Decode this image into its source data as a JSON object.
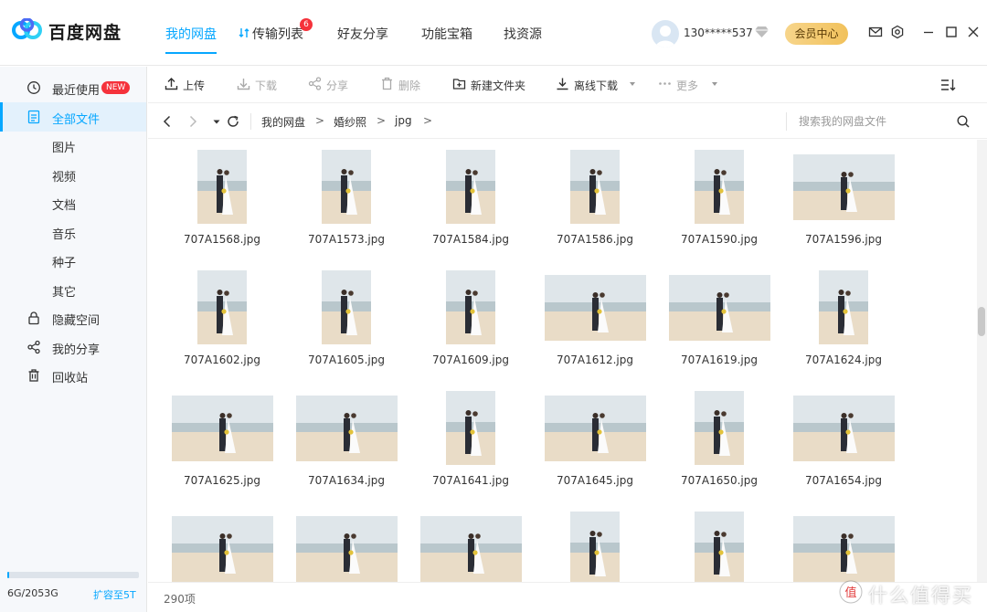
{
  "app": {
    "brand": "百度网盘"
  },
  "nav": {
    "tabs": [
      {
        "label": "我的网盘"
      },
      {
        "label": "传输列表",
        "badge": "6"
      },
      {
        "label": "好友分享"
      },
      {
        "label": "功能宝箱"
      },
      {
        "label": "找资源"
      }
    ]
  },
  "user": {
    "name": "130*****537",
    "vip_button": "会员中心"
  },
  "sidebar": {
    "items": [
      {
        "label": "最近使用",
        "icon": "clock-icon",
        "badge": "NEW"
      },
      {
        "label": "全部文件",
        "icon": "document-icon"
      },
      {
        "label": "图片"
      },
      {
        "label": "视频"
      },
      {
        "label": "文档"
      },
      {
        "label": "音乐"
      },
      {
        "label": "种子"
      },
      {
        "label": "其它"
      },
      {
        "label": "隐藏空间",
        "icon": "lock-icon"
      },
      {
        "label": "我的分享",
        "icon": "share-icon"
      },
      {
        "label": "回收站",
        "icon": "trash-icon"
      }
    ],
    "storage": {
      "text": "6G/2053G",
      "used_fraction": 0.003,
      "expand": "扩容至5T"
    }
  },
  "toolbar": {
    "upload": "上传",
    "download": "下载",
    "share": "分享",
    "delete": "删除",
    "new_folder": "新建文件夹",
    "offline_download": "离线下载",
    "more": "更多"
  },
  "path": {
    "crumbs": [
      "我的网盘",
      "婚纱照",
      "jpg"
    ],
    "search_placeholder": "搜索我的网盘文件"
  },
  "files": [
    {
      "name": "707A1568.jpg",
      "orient": "portrait"
    },
    {
      "name": "707A1573.jpg",
      "orient": "portrait"
    },
    {
      "name": "707A1584.jpg",
      "orient": "portrait"
    },
    {
      "name": "707A1586.jpg",
      "orient": "portrait"
    },
    {
      "name": "707A1590.jpg",
      "orient": "portrait"
    },
    {
      "name": "707A1596.jpg",
      "orient": "landscape"
    },
    {
      "name": "707A1602.jpg",
      "orient": "portrait"
    },
    {
      "name": "707A1605.jpg",
      "orient": "portrait"
    },
    {
      "name": "707A1609.jpg",
      "orient": "portrait"
    },
    {
      "name": "707A1612.jpg",
      "orient": "landscape"
    },
    {
      "name": "707A1619.jpg",
      "orient": "landscape"
    },
    {
      "name": "707A1624.jpg",
      "orient": "portrait"
    },
    {
      "name": "707A1625.jpg",
      "orient": "landscape"
    },
    {
      "name": "707A1634.jpg",
      "orient": "landscape"
    },
    {
      "name": "707A1641.jpg",
      "orient": "portrait"
    },
    {
      "name": "707A1645.jpg",
      "orient": "landscape"
    },
    {
      "name": "707A1650.jpg",
      "orient": "portrait"
    },
    {
      "name": "707A1654.jpg",
      "orient": "landscape"
    },
    {
      "name": "",
      "orient": "landscape"
    },
    {
      "name": "",
      "orient": "landscape"
    },
    {
      "name": "",
      "orient": "landscape"
    },
    {
      "name": "",
      "orient": "portrait"
    },
    {
      "name": "",
      "orient": "portrait"
    },
    {
      "name": "",
      "orient": "landscape"
    }
  ],
  "status": {
    "count": "290项"
  },
  "watermark": {
    "text": "值 什么值得买"
  },
  "colors": {
    "accent": "#06a7ff",
    "badge": "#f5323b",
    "vip": "#f1c15b"
  }
}
